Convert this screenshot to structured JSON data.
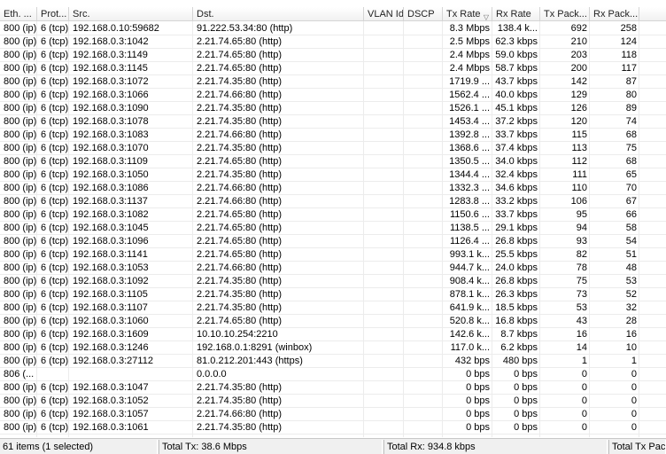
{
  "columns": {
    "eth": "Eth. ...",
    "proto": "Prot...",
    "src": "Src.",
    "dst": "Dst.",
    "vlan": "VLAN Id",
    "dscp": "DSCP",
    "tx_rate": "Tx Rate",
    "rx_rate": "Rx Rate",
    "tx_pack": "Tx Pack...",
    "rx_pack": "Rx Pack..."
  },
  "sort_icon": "sort-descending-icon",
  "rows": [
    {
      "eth": "800 (ip)",
      "proto": "6 (tcp)",
      "src": "192.168.0.10:59682",
      "dst": "91.222.53.34:80 (http)",
      "tx": "8.3 Mbps",
      "rx": "138.4 k...",
      "txp": "692",
      "rxp": "258",
      "selected": true
    },
    {
      "eth": "800 (ip)",
      "proto": "6 (tcp)",
      "src": "192.168.0.3:1042",
      "dst": "2.21.74.65:80 (http)",
      "tx": "2.5 Mbps",
      "rx": "62.3 kbps",
      "txp": "210",
      "rxp": "124"
    },
    {
      "eth": "800 (ip)",
      "proto": "6 (tcp)",
      "src": "192.168.0.3:1149",
      "dst": "2.21.74.65:80 (http)",
      "tx": "2.4 Mbps",
      "rx": "59.0 kbps",
      "txp": "203",
      "rxp": "118"
    },
    {
      "eth": "800 (ip)",
      "proto": "6 (tcp)",
      "src": "192.168.0.3:1145",
      "dst": "2.21.74.65:80 (http)",
      "tx": "2.4 Mbps",
      "rx": "58.7 kbps",
      "txp": "200",
      "rxp": "117"
    },
    {
      "eth": "800 (ip)",
      "proto": "6 (tcp)",
      "src": "192.168.0.3:1072",
      "dst": "2.21.74.35:80 (http)",
      "tx": "1719.9 ...",
      "rx": "43.7 kbps",
      "txp": "142",
      "rxp": "87"
    },
    {
      "eth": "800 (ip)",
      "proto": "6 (tcp)",
      "src": "192.168.0.3:1066",
      "dst": "2.21.74.66:80 (http)",
      "tx": "1562.4 ...",
      "rx": "40.0 kbps",
      "txp": "129",
      "rxp": "80"
    },
    {
      "eth": "800 (ip)",
      "proto": "6 (tcp)",
      "src": "192.168.0.3:1090",
      "dst": "2.21.74.35:80 (http)",
      "tx": "1526.1 ...",
      "rx": "45.1 kbps",
      "txp": "126",
      "rxp": "89"
    },
    {
      "eth": "800 (ip)",
      "proto": "6 (tcp)",
      "src": "192.168.0.3:1078",
      "dst": "2.21.74.35:80 (http)",
      "tx": "1453.4 ...",
      "rx": "37.2 kbps",
      "txp": "120",
      "rxp": "74"
    },
    {
      "eth": "800 (ip)",
      "proto": "6 (tcp)",
      "src": "192.168.0.3:1083",
      "dst": "2.21.74.66:80 (http)",
      "tx": "1392.8 ...",
      "rx": "33.7 kbps",
      "txp": "115",
      "rxp": "68"
    },
    {
      "eth": "800 (ip)",
      "proto": "6 (tcp)",
      "src": "192.168.0.3:1070",
      "dst": "2.21.74.35:80 (http)",
      "tx": "1368.6 ...",
      "rx": "37.4 kbps",
      "txp": "113",
      "rxp": "75"
    },
    {
      "eth": "800 (ip)",
      "proto": "6 (tcp)",
      "src": "192.168.0.3:1109",
      "dst": "2.21.74.65:80 (http)",
      "tx": "1350.5 ...",
      "rx": "34.0 kbps",
      "txp": "112",
      "rxp": "68"
    },
    {
      "eth": "800 (ip)",
      "proto": "6 (tcp)",
      "src": "192.168.0.3:1050",
      "dst": "2.21.74.35:80 (http)",
      "tx": "1344.4 ...",
      "rx": "32.4 kbps",
      "txp": "111",
      "rxp": "65"
    },
    {
      "eth": "800 (ip)",
      "proto": "6 (tcp)",
      "src": "192.168.0.3:1086",
      "dst": "2.21.74.66:80 (http)",
      "tx": "1332.3 ...",
      "rx": "34.6 kbps",
      "txp": "110",
      "rxp": "70"
    },
    {
      "eth": "800 (ip)",
      "proto": "6 (tcp)",
      "src": "192.168.0.3:1137",
      "dst": "2.21.74.66:80 (http)",
      "tx": "1283.8 ...",
      "rx": "33.2 kbps",
      "txp": "106",
      "rxp": "67"
    },
    {
      "eth": "800 (ip)",
      "proto": "6 (tcp)",
      "src": "192.168.0.3:1082",
      "dst": "2.21.74.65:80 (http)",
      "tx": "1150.6 ...",
      "rx": "33.7 kbps",
      "txp": "95",
      "rxp": "66"
    },
    {
      "eth": "800 (ip)",
      "proto": "6 (tcp)",
      "src": "192.168.0.3:1045",
      "dst": "2.21.74.65:80 (http)",
      "tx": "1138.5 ...",
      "rx": "29.1 kbps",
      "txp": "94",
      "rxp": "58"
    },
    {
      "eth": "800 (ip)",
      "proto": "6 (tcp)",
      "src": "192.168.0.3:1096",
      "dst": "2.21.74.65:80 (http)",
      "tx": "1126.4 ...",
      "rx": "26.8 kbps",
      "txp": "93",
      "rxp": "54"
    },
    {
      "eth": "800 (ip)",
      "proto": "6 (tcp)",
      "src": "192.168.0.3:1141",
      "dst": "2.21.74.65:80 (http)",
      "tx": "993.1 k...",
      "rx": "25.5 kbps",
      "txp": "82",
      "rxp": "51"
    },
    {
      "eth": "800 (ip)",
      "proto": "6 (tcp)",
      "src": "192.168.0.3:1053",
      "dst": "2.21.74.66:80 (http)",
      "tx": "944.7 k...",
      "rx": "24.0 kbps",
      "txp": "78",
      "rxp": "48"
    },
    {
      "eth": "800 (ip)",
      "proto": "6 (tcp)",
      "src": "192.168.0.3:1092",
      "dst": "2.21.74.35:80 (http)",
      "tx": "908.4 k...",
      "rx": "26.8 kbps",
      "txp": "75",
      "rxp": "53"
    },
    {
      "eth": "800 (ip)",
      "proto": "6 (tcp)",
      "src": "192.168.0.3:1105",
      "dst": "2.21.74.35:80 (http)",
      "tx": "878.1 k...",
      "rx": "26.3 kbps",
      "txp": "73",
      "rxp": "52"
    },
    {
      "eth": "800 (ip)",
      "proto": "6 (tcp)",
      "src": "192.168.0.3:1107",
      "dst": "2.21.74.35:80 (http)",
      "tx": "641.9 k...",
      "rx": "18.5 kbps",
      "txp": "53",
      "rxp": "32"
    },
    {
      "eth": "800 (ip)",
      "proto": "6 (tcp)",
      "src": "192.168.0.3:1060",
      "dst": "2.21.74.65:80 (http)",
      "tx": "520.8 k...",
      "rx": "16.8 kbps",
      "txp": "43",
      "rxp": "28"
    },
    {
      "eth": "800 (ip)",
      "proto": "6 (tcp)",
      "src": "192.168.0.3:1609",
      "dst": "10.10.10.254:2210",
      "tx": "142.6 k...",
      "rx": "8.7 kbps",
      "txp": "16",
      "rxp": "16"
    },
    {
      "eth": "800 (ip)",
      "proto": "6 (tcp)",
      "src": "192.168.0.3:1246",
      "dst": "192.168.0.1:8291 (winbox)",
      "tx": "117.0 k...",
      "rx": "6.2 kbps",
      "txp": "14",
      "rxp": "10"
    },
    {
      "eth": "800 (ip)",
      "proto": "6 (tcp)",
      "src": "192.168.0.3:27112",
      "dst": "81.0.212.201:443 (https)",
      "tx": "432 bps",
      "rx": "480 bps",
      "txp": "1",
      "rxp": "1"
    },
    {
      "eth": "806 (...",
      "proto": "",
      "src": "",
      "dst": "0.0.0.0",
      "tx": "0 bps",
      "rx": "0 bps",
      "txp": "0",
      "rxp": "0"
    },
    {
      "eth": "800 (ip)",
      "proto": "6 (tcp)",
      "src": "192.168.0.3:1047",
      "dst": "2.21.74.35:80 (http)",
      "tx": "0 bps",
      "rx": "0 bps",
      "txp": "0",
      "rxp": "0"
    },
    {
      "eth": "800 (ip)",
      "proto": "6 (tcp)",
      "src": "192.168.0.3:1052",
      "dst": "2.21.74.35:80 (http)",
      "tx": "0 bps",
      "rx": "0 bps",
      "txp": "0",
      "rxp": "0"
    },
    {
      "eth": "800 (ip)",
      "proto": "6 (tcp)",
      "src": "192.168.0.3:1057",
      "dst": "2.21.74.66:80 (http)",
      "tx": "0 bps",
      "rx": "0 bps",
      "txp": "0",
      "rxp": "0"
    },
    {
      "eth": "800 (ip)",
      "proto": "6 (tcp)",
      "src": "192.168.0.3:1061",
      "dst": "2.21.74.35:80 (http)",
      "tx": "0 bps",
      "rx": "0 bps",
      "txp": "0",
      "rxp": "0"
    }
  ],
  "status": {
    "items": "61 items (1 selected)",
    "total_tx": "Total Tx: 38.6 Mbps",
    "total_rx": "Total Rx: 934.8 kbps",
    "total_tx_pack": "Total Tx Pack"
  }
}
